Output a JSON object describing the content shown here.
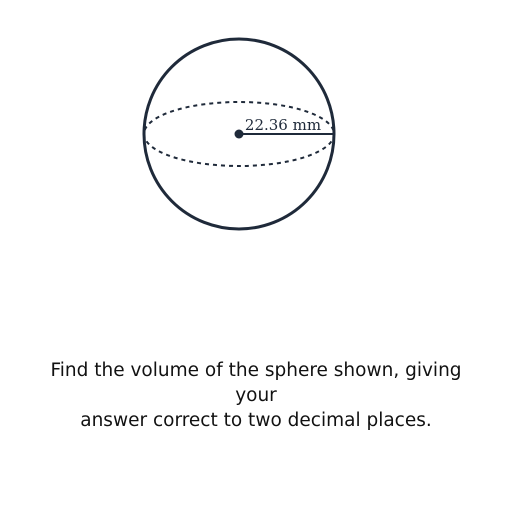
{
  "diagram": {
    "shape": "sphere",
    "radius_label": "22.36 mm",
    "stroke_color": "#1f2a3a"
  },
  "question": {
    "line1": "Find the volume of the sphere shown, giving your",
    "line2": "answer correct to two decimal places."
  }
}
